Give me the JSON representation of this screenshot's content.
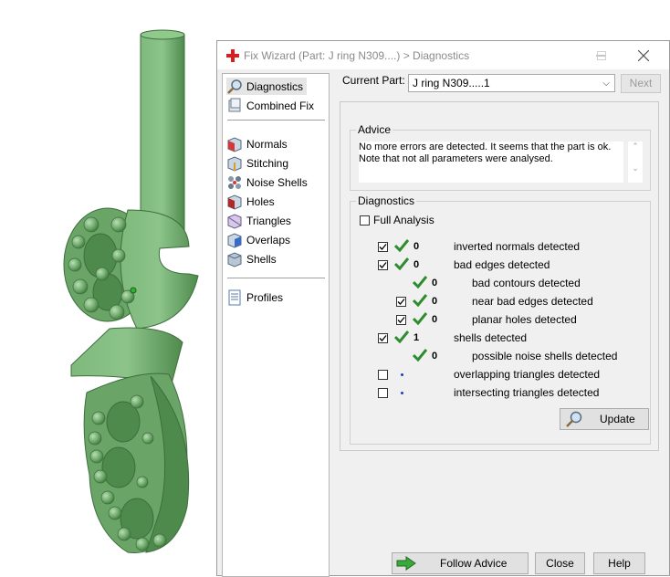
{
  "window": {
    "title": "Fix Wizard (Part: J ring N309....) > Diagnostics"
  },
  "nav": {
    "items": [
      {
        "label": "Diagnostics",
        "icon": "magnifier-icon"
      },
      {
        "label": "Combined Fix",
        "icon": "combined-fix-icon"
      },
      {
        "label": "Normals",
        "icon": "normals-cube-icon"
      },
      {
        "label": "Stitching",
        "icon": "stitching-cube-icon"
      },
      {
        "label": "Noise Shells",
        "icon": "noise-shells-icon"
      },
      {
        "label": "Holes",
        "icon": "holes-cube-icon"
      },
      {
        "label": "Triangles",
        "icon": "triangles-cube-icon"
      },
      {
        "label": "Overlaps",
        "icon": "overlaps-cube-icon"
      },
      {
        "label": "Shells",
        "icon": "shells-cube-icon"
      },
      {
        "label": "Profiles",
        "icon": "profiles-document-icon"
      }
    ],
    "selected": "Diagnostics"
  },
  "part": {
    "label": "Current Part:",
    "value": "J ring N309.....1",
    "next_label": "Next"
  },
  "advice": {
    "title": "Advice",
    "line1": "No more errors are detected. It seems that the part is ok.",
    "line2": "Note that not all parameters were analysed."
  },
  "diagnostics": {
    "title": "Diagnostics",
    "full_analysis_label": "Full Analysis",
    "rows": [
      {
        "label": "inverted normals detected",
        "count": "0",
        "checkbox": true,
        "checked": true,
        "status": "ok"
      },
      {
        "label": "bad edges detected",
        "count": "0",
        "checkbox": true,
        "checked": true,
        "status": "ok"
      },
      {
        "label": "bad contours detected",
        "count": "0",
        "checkbox": false,
        "checked": false,
        "status": "ok"
      },
      {
        "label": "near bad edges detected",
        "count": "0",
        "checkbox": true,
        "checked": true,
        "status": "ok"
      },
      {
        "label": "planar holes detected",
        "count": "0",
        "checkbox": true,
        "checked": true,
        "status": "ok"
      },
      {
        "label": "shells detected",
        "count": "1",
        "checkbox": true,
        "checked": true,
        "status": "ok"
      },
      {
        "label": "possible noise shells detected",
        "count": "0",
        "checkbox": false,
        "checked": false,
        "status": "ok"
      },
      {
        "label": "overlapping triangles detected",
        "count": "",
        "checkbox": true,
        "checked": false,
        "status": "not-analysed"
      },
      {
        "label": "intersecting triangles detected",
        "count": "",
        "checkbox": true,
        "checked": false,
        "status": "not-analysed"
      }
    ],
    "update_label": "Update"
  },
  "buttons": {
    "follow_advice": "Follow Advice",
    "close": "Close",
    "help": "Help"
  },
  "colors": {
    "model_green": "#6ea86c",
    "tick_green": "#2e8b2e",
    "dialog_bg": "#f0f0f0",
    "title_cross_red": "#d81e1e"
  }
}
